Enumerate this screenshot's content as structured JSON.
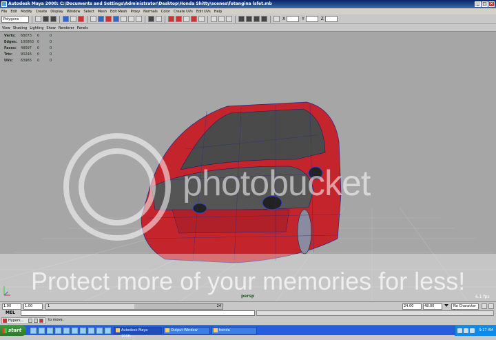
{
  "window": {
    "title": "Autodesk Maya 2008: C:\\Documents and Settings\\Administrator\\Desktop\\Honda Shitty\\scenes\\fotangina lsfet.mb",
    "minimize": "_",
    "maximize": "□",
    "close": "×"
  },
  "menubar": [
    "File",
    "Edit",
    "Modify",
    "Create",
    "Display",
    "Window",
    "Select",
    "Mesh",
    "Edit Mesh",
    "Proxy",
    "Normals",
    "Color",
    "Create UVs",
    "Edit UVs",
    "Help"
  ],
  "statusline": {
    "mode": "Polygons",
    "coord_x_label": "X",
    "coord_y_label": "Y",
    "coord_z_label": "Z"
  },
  "panelmenu": [
    "View",
    "Shading",
    "Lighting",
    "Show",
    "Renderer",
    "Panels"
  ],
  "hud": [
    {
      "label": "Verts:",
      "v1": "68073",
      "v2": "0",
      "v3": "0"
    },
    {
      "label": "Edges:",
      "v1": "100863",
      "v2": "0",
      "v3": "0"
    },
    {
      "label": "Faces:",
      "v1": "48097",
      "v2": "0",
      "v3": "0"
    },
    {
      "label": "Tris:",
      "v1": "93246",
      "v2": "0",
      "v3": "0"
    },
    {
      "label": "UVs:",
      "v1": "63965",
      "v2": "0",
      "v3": "0"
    }
  ],
  "viewport": {
    "camera": "persp",
    "fps": "6.1 fps"
  },
  "watermark": {
    "brand": "photobucket",
    "tagline": "Protect more of your memories for less!"
  },
  "timeslider": {
    "start": "1.00",
    "current": "1.00",
    "range_start_frame": "1",
    "range_end_frame": "24",
    "range_fill": 0.5,
    "playback_end": "24.00",
    "anim_end": "48.00",
    "character_set": "No Character Set"
  },
  "mel": {
    "label": "MEL"
  },
  "helpline": {
    "hypershade_title": "Hypers...",
    "text": "to move."
  },
  "taskbar": {
    "start": "start",
    "tasks": [
      "Autodesk Maya 2008:...",
      "Output Window",
      "honda"
    ],
    "clock": "9:17 AM"
  },
  "colors": {
    "car_body": "#c4252d",
    "viewport_bg": "#a6a6a6",
    "taskbar": "#245edb"
  }
}
